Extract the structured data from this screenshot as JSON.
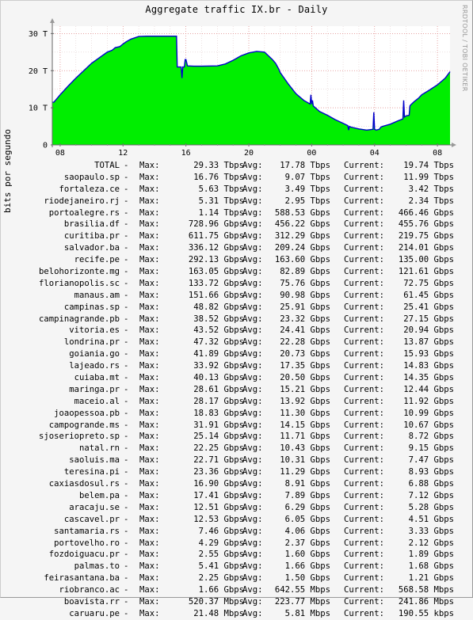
{
  "title": "Aggregate traffic IX.br - Daily",
  "watermark": "RRDTOOL / TOBI OETIKER",
  "chart_data": {
    "type": "area",
    "title": "Aggregate traffic IX.br - Daily",
    "ylabel": "bits por segundo",
    "xlabel": "",
    "unit": "T",
    "ylim": [
      0,
      32
    ],
    "xlim": [
      7.5,
      32.8
    ],
    "yticks": [
      0,
      10,
      20,
      30
    ],
    "ytick_labels": [
      "0",
      "10 T",
      "20 T",
      "30 T"
    ],
    "xticks": [
      8,
      12,
      16,
      20,
      24,
      28,
      32
    ],
    "xtick_labels": [
      "08",
      "12",
      "16",
      "20",
      "00",
      "04",
      "08"
    ],
    "grid": true,
    "fill_color": "#00ee00",
    "line_color": "#0000cc",
    "series": [
      {
        "x": [
          7.5,
          7.6,
          8.0,
          8.5,
          9.0,
          9.5,
          10.0,
          10.5,
          11.0,
          11.3,
          11.5,
          11.8,
          12.0,
          12.2,
          12.5,
          13.0,
          13.5,
          14.0,
          14.5,
          15.0,
          15.4,
          15.45,
          15.6,
          15.7,
          15.75,
          15.8,
          15.9,
          15.95,
          16.0,
          16.1,
          16.5,
          17.0,
          18.0,
          18.5,
          19.0,
          19.5,
          20.0,
          20.5,
          21.0,
          21.5,
          21.7,
          21.9,
          22.0,
          22.5,
          23.0,
          23.5,
          23.9,
          23.95,
          24.0,
          24.05,
          24.1,
          24.5,
          25.0,
          25.5,
          26.0,
          26.3,
          26.35,
          26.4,
          26.5,
          27.0,
          27.5,
          27.9,
          27.95,
          28.0,
          28.1,
          28.3,
          28.35,
          28.4,
          28.5,
          29.0,
          29.5,
          29.8,
          29.85,
          29.9,
          30.0,
          30.2,
          30.25,
          30.3,
          30.5,
          30.8,
          31.0,
          31.5,
          32.0,
          32.5,
          32.8
        ],
        "values": [
          11.5,
          11.5,
          13.5,
          15.8,
          18.0,
          20.0,
          22.0,
          23.5,
          25.0,
          25.5,
          26.2,
          26.5,
          27.2,
          27.8,
          28.5,
          29.2,
          29.3,
          29.3,
          29.3,
          29.3,
          29.3,
          21.0,
          21.0,
          21.0,
          18.0,
          21.0,
          21.0,
          23.0,
          23.0,
          21.3,
          21.2,
          21.2,
          21.3,
          21.8,
          22.8,
          24.0,
          24.8,
          25.2,
          25.0,
          23.0,
          22.0,
          20.5,
          19.5,
          16.5,
          13.8,
          12.0,
          11.0,
          13.5,
          11.0,
          12.0,
          10.5,
          9.0,
          8.0,
          6.8,
          5.8,
          5.2,
          4.0,
          5.0,
          4.8,
          4.3,
          4.0,
          4.2,
          8.8,
          4.2,
          4.0,
          4.2,
          4.5,
          4.8,
          5.0,
          5.6,
          6.5,
          7.0,
          12.0,
          7.5,
          7.8,
          8.0,
          10.5,
          10.8,
          11.6,
          12.6,
          13.5,
          14.8,
          16.2,
          18.0,
          19.74
        ]
      }
    ]
  },
  "legend_labels": {
    "max": "Max:",
    "avg": "Avg:",
    "current": "Current:"
  },
  "legend": [
    {
      "name": "TOTAL -",
      "max": "29.33 Tbps",
      "avg": "17.78 Tbps",
      "current": "19.74 Tbps"
    },
    {
      "name": "saopaulo.sp -",
      "max": "16.76 Tbps",
      "avg": "9.07 Tbps",
      "current": "11.99 Tbps"
    },
    {
      "name": "fortaleza.ce -",
      "max": "5.63 Tbps",
      "avg": "3.49 Tbps",
      "current": "3.42 Tbps"
    },
    {
      "name": "riodejaneiro.rj -",
      "max": "5.31 Tbps",
      "avg": "2.95 Tbps",
      "current": "2.34 Tbps"
    },
    {
      "name": "portoalegre.rs -",
      "max": "1.14 Tbps",
      "avg": "588.53 Gbps",
      "current": "466.46 Gbps"
    },
    {
      "name": "brasilia.df -",
      "max": "728.96 Gbps",
      "avg": "456.22 Gbps",
      "current": "455.76 Gbps"
    },
    {
      "name": "curitiba.pr -",
      "max": "611.75 Gbps",
      "avg": "312.29 Gbps",
      "current": "219.75 Gbps"
    },
    {
      "name": "salvador.ba -",
      "max": "336.12 Gbps",
      "avg": "209.24 Gbps",
      "current": "214.01 Gbps"
    },
    {
      "name": "recife.pe -",
      "max": "292.13 Gbps",
      "avg": "163.60 Gbps",
      "current": "135.00 Gbps"
    },
    {
      "name": "belohorizonte.mg -",
      "max": "163.05 Gbps",
      "avg": "82.89 Gbps",
      "current": "121.61 Gbps"
    },
    {
      "name": "florianopolis.sc -",
      "max": "133.72 Gbps",
      "avg": "75.76 Gbps",
      "current": "72.75 Gbps"
    },
    {
      "name": "manaus.am -",
      "max": "151.66 Gbps",
      "avg": "90.98 Gbps",
      "current": "61.45 Gbps"
    },
    {
      "name": "campinas.sp -",
      "max": "48.82 Gbps",
      "avg": "25.91 Gbps",
      "current": "25.41 Gbps"
    },
    {
      "name": "campinagrande.pb -",
      "max": "38.52 Gbps",
      "avg": "23.32 Gbps",
      "current": "27.15 Gbps"
    },
    {
      "name": "vitoria.es -",
      "max": "43.52 Gbps",
      "avg": "24.41 Gbps",
      "current": "20.94 Gbps"
    },
    {
      "name": "londrina.pr -",
      "max": "47.32 Gbps",
      "avg": "22.28 Gbps",
      "current": "13.87 Gbps"
    },
    {
      "name": "goiania.go -",
      "max": "41.89 Gbps",
      "avg": "20.73 Gbps",
      "current": "15.93 Gbps"
    },
    {
      "name": "lajeado.rs -",
      "max": "33.92 Gbps",
      "avg": "17.35 Gbps",
      "current": "14.83 Gbps"
    },
    {
      "name": "cuiaba.mt -",
      "max": "40.13 Gbps",
      "avg": "20.50 Gbps",
      "current": "14.35 Gbps"
    },
    {
      "name": "maringa.pr -",
      "max": "28.61 Gbps",
      "avg": "15.21 Gbps",
      "current": "12.44 Gbps"
    },
    {
      "name": "maceio.al -",
      "max": "28.17 Gbps",
      "avg": "13.92 Gbps",
      "current": "11.92 Gbps"
    },
    {
      "name": "joaopessoa.pb -",
      "max": "18.83 Gbps",
      "avg": "11.30 Gbps",
      "current": "10.99 Gbps"
    },
    {
      "name": "campogrande.ms -",
      "max": "31.91 Gbps",
      "avg": "14.15 Gbps",
      "current": "10.67 Gbps"
    },
    {
      "name": "sjoseriopreto.sp -",
      "max": "25.14 Gbps",
      "avg": "11.71 Gbps",
      "current": "8.72 Gbps"
    },
    {
      "name": "natal.rn -",
      "max": "22.25 Gbps",
      "avg": "10.43 Gbps",
      "current": "9.15 Gbps"
    },
    {
      "name": "saoluis.ma -",
      "max": "22.71 Gbps",
      "avg": "10.31 Gbps",
      "current": "7.47 Gbps"
    },
    {
      "name": "teresina.pi -",
      "max": "23.36 Gbps",
      "avg": "11.29 Gbps",
      "current": "8.93 Gbps"
    },
    {
      "name": "caxiasdosul.rs -",
      "max": "16.90 Gbps",
      "avg": "8.91 Gbps",
      "current": "6.88 Gbps"
    },
    {
      "name": "belem.pa -",
      "max": "17.41 Gbps",
      "avg": "7.89 Gbps",
      "current": "7.12 Gbps"
    },
    {
      "name": "aracaju.se -",
      "max": "12.51 Gbps",
      "avg": "6.29 Gbps",
      "current": "5.28 Gbps"
    },
    {
      "name": "cascavel.pr -",
      "max": "12.53 Gbps",
      "avg": "6.05 Gbps",
      "current": "4.51 Gbps"
    },
    {
      "name": "santamaria.rs -",
      "max": "7.46 Gbps",
      "avg": "4.06 Gbps",
      "current": "3.33 Gbps"
    },
    {
      "name": "portovelho.ro -",
      "max": "4.29 Gbps",
      "avg": "2.37 Gbps",
      "current": "2.12 Gbps"
    },
    {
      "name": "fozdoiguacu.pr -",
      "max": "2.55 Gbps",
      "avg": "1.60 Gbps",
      "current": "1.89 Gbps"
    },
    {
      "name": "palmas.to -",
      "max": "5.41 Gbps",
      "avg": "1.66 Gbps",
      "current": "1.68 Gbps"
    },
    {
      "name": "feirasantana.ba -",
      "max": "2.25 Gbps",
      "avg": "1.50 Gbps",
      "current": "1.21 Gbps"
    },
    {
      "name": "riobranco.ac -",
      "max": "1.66 Gbps",
      "avg": "642.55 Mbps",
      "current": "568.58 Mbps"
    },
    {
      "name": "boavista.rr -",
      "max": "520.37 Mbps",
      "avg": "223.77 Mbps",
      "current": "241.86 Mbps"
    },
    {
      "name": "caruaru.pe -",
      "max": "21.48 Mbps",
      "avg": "5.81 Mbps",
      "current": "190.55 kbps"
    }
  ]
}
